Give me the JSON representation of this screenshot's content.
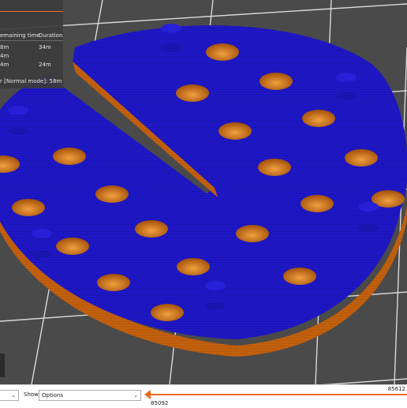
{
  "legend": {
    "headers": {
      "remaining": "emaining time",
      "duration": "Duration"
    },
    "rows": [
      {
        "remaining": "8m",
        "duration": "34m"
      },
      {
        "remaining": "4m",
        "duration": ""
      },
      {
        "remaining": "4m",
        "duration": "24m"
      }
    ],
    "mode_line": "r [Normal mode]:  58m"
  },
  "bottom_bar": {
    "view_combo": {
      "value": ""
    },
    "show_label": "Show",
    "show_combo": {
      "value": "Options"
    }
  },
  "layer_slider": {
    "upper_value": "85612",
    "lower_value": "85092",
    "position_fraction": 0.0
  },
  "colors": {
    "bed": "#4a4a4a",
    "grid_line": "#d9d9d9",
    "top_surface": "#1f18c9",
    "perimeter": "#c9650f",
    "accent": "#ed6b21"
  }
}
